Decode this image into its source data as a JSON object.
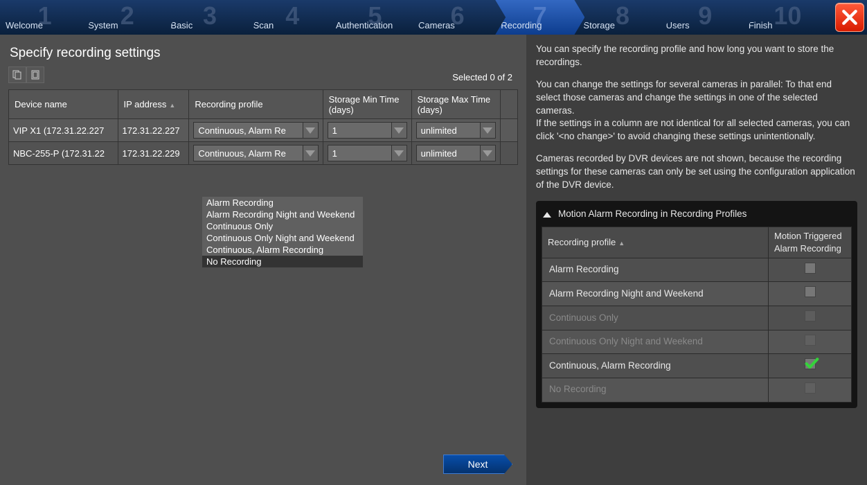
{
  "wizard": {
    "steps": [
      {
        "num": "1",
        "label": "Welcome"
      },
      {
        "num": "2",
        "label": "System"
      },
      {
        "num": "3",
        "label": "Basic"
      },
      {
        "num": "4",
        "label": "Scan"
      },
      {
        "num": "5",
        "label": "Authentication"
      },
      {
        "num": "6",
        "label": "Cameras"
      },
      {
        "num": "7",
        "label": "Recording"
      },
      {
        "num": "8",
        "label": "Storage"
      },
      {
        "num": "9",
        "label": "Users"
      },
      {
        "num": "10",
        "label": "Finish"
      }
    ],
    "active_index": 6
  },
  "page": {
    "title": "Specify recording settings",
    "selected_text": "Selected 0 of 2"
  },
  "columns": {
    "device": "Device name",
    "ip": "IP address",
    "profile": "Recording profile",
    "min": "Storage Min Time (days)",
    "max": "Storage Max Time (days)"
  },
  "rows": [
    {
      "device": "VIP X1 (172.31.22.227",
      "ip": "172.31.22.227",
      "profile": "Continuous, Alarm Re",
      "min": "1",
      "max": "unlimited"
    },
    {
      "device": "NBC-255-P (172.31.22",
      "ip": "172.31.22.229",
      "profile": "Continuous, Alarm Re",
      "min": "1",
      "max": "unlimited"
    }
  ],
  "profile_options": [
    "Alarm Recording",
    "Alarm Recording Night and Weekend",
    "Continuous Only",
    "Continuous Only Night and Weekend",
    "Continuous, Alarm Recording",
    "No Recording"
  ],
  "option_hover_index": 5,
  "help": {
    "p1": "You can specify the recording profile and how long you want to store the recordings.",
    "p2": "You can change the settings for several cameras in parallel: To that end select those cameras and change the settings in one of the selected cameras.",
    "p3": "If the settings in a column are not identical for all selected cameras, you can click '<no change>' to avoid changing these settings unintentionally.",
    "p4": "Cameras recorded by DVR devices are not shown, because the recording settings for these cameras can only be set using the configuration application of the DVR device."
  },
  "profiles_panel": {
    "title": "Motion Alarm Recording in Recording Profiles",
    "col_profile": "Recording profile",
    "col_motion": "Motion Triggered Alarm Recording",
    "rows": [
      {
        "name": "Alarm Recording",
        "dim": false,
        "checked": false
      },
      {
        "name": "Alarm Recording Night and Weekend",
        "dim": false,
        "checked": false
      },
      {
        "name": "Continuous Only",
        "dim": true,
        "checked": false
      },
      {
        "name": "Continuous Only Night and Weekend",
        "dim": true,
        "checked": false
      },
      {
        "name": "Continuous, Alarm Recording",
        "dim": false,
        "checked": true
      },
      {
        "name": "No Recording",
        "dim": true,
        "checked": false
      }
    ]
  },
  "buttons": {
    "next": "Next"
  }
}
